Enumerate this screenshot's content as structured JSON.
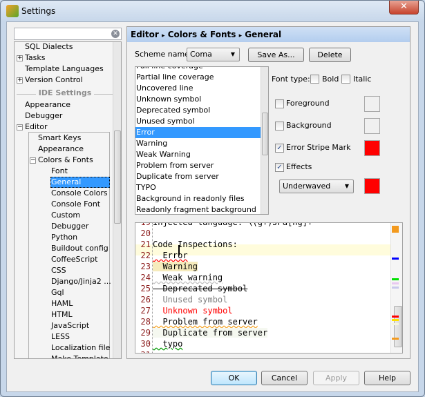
{
  "window": {
    "title": "Settings",
    "close": "✕"
  },
  "sidebar": {
    "search": {
      "value": "",
      "placeholder": ""
    },
    "items": [
      {
        "label": "SQL Dialects",
        "level": 1,
        "expander": ""
      },
      {
        "label": "Tasks",
        "level": 1,
        "expander": "+"
      },
      {
        "label": "Template Languages",
        "level": 1,
        "expander": ""
      },
      {
        "label": "Version Control",
        "level": 1,
        "expander": "+"
      }
    ],
    "section": "IDE Settings",
    "ide_items": [
      {
        "label": "Appearance",
        "expander": ""
      },
      {
        "label": "Debugger",
        "expander": ""
      },
      {
        "label": "Editor",
        "expander": "−"
      }
    ],
    "editor_items": [
      {
        "label": "Smart Keys"
      },
      {
        "label": "Appearance"
      },
      {
        "label": "Colors & Fonts",
        "expander": "−"
      }
    ],
    "color_items": [
      "Font",
      "General",
      "Console Colors",
      "Console Font",
      "Custom",
      "Debugger",
      "Python",
      "Buildout config",
      "CoffeeScript",
      "CSS",
      "Django/Jinja2 ...",
      "Gql",
      "HAML",
      "HTML",
      "JavaScript",
      "LESS",
      "Localization file",
      "Make Template"
    ],
    "selected": "General"
  },
  "header": {
    "crumbs": [
      "Editor",
      "Colors & Fonts",
      "General"
    ],
    "sep": "▸"
  },
  "scheme": {
    "label": "Scheme name:",
    "value": "Coma",
    "save_as": "Save As...",
    "delete": "Delete"
  },
  "attributes": {
    "items": [
      "Full line coverage",
      "Partial line coverage",
      "Uncovered line",
      "Unknown symbol",
      "Deprecated symbol",
      "Unused symbol",
      "Error",
      "Warning",
      "Weak Warning",
      "Problem from server",
      "Duplicate from server",
      "TYPO",
      "Background in readonly files",
      "Readonly fragment background"
    ],
    "selected": "Error"
  },
  "options": {
    "font_type": "Font type:",
    "bold": "Bold",
    "italic": "Italic",
    "bold_checked": false,
    "italic_checked": false,
    "foreground": "Foreground",
    "foreground_checked": false,
    "background": "Background",
    "background_checked": false,
    "error_stripe": "Error Stripe Mark",
    "error_stripe_checked": true,
    "error_stripe_color": "#ff0000",
    "effects": "Effects",
    "effects_checked": true,
    "effect_type": "Underwaved",
    "effect_color": "#ff0000"
  },
  "preview": {
    "lines": [
      {
        "n": "19",
        "text": "Injected language: \\(g+)JPa[ng]+"
      },
      {
        "n": "20",
        "text": ""
      },
      {
        "n": "21",
        "text": "Code Inspections:"
      },
      {
        "n": "22",
        "text": "  Error"
      },
      {
        "n": "23",
        "text": "  Warning"
      },
      {
        "n": "24",
        "text": "  Weak warning"
      },
      {
        "n": "25",
        "text": "  Deprecated symbol"
      },
      {
        "n": "26",
        "text": "  Unused symbol"
      },
      {
        "n": "27",
        "text": "  Unknown symbol"
      },
      {
        "n": "28",
        "text": "  Problem from server"
      },
      {
        "n": "29",
        "text": "  Duplicate from server"
      },
      {
        "n": "30",
        "text": "  typo"
      },
      {
        "n": "31",
        "text": ""
      }
    ]
  },
  "buttons": {
    "ok": "OK",
    "cancel": "Cancel",
    "apply": "Apply",
    "help": "Help"
  }
}
